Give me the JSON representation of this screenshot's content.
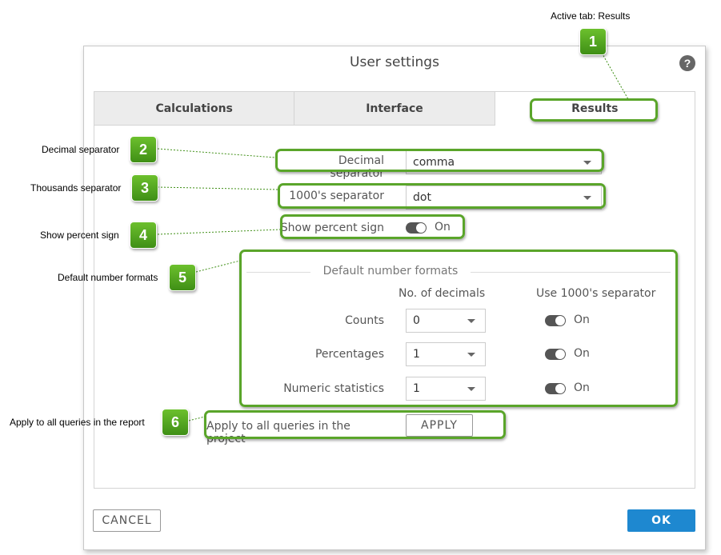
{
  "dialog": {
    "title": "User settings",
    "help_glyph": "?",
    "tabs": [
      {
        "label": "Calculations",
        "active": false
      },
      {
        "label": "Interface",
        "active": false
      },
      {
        "label": "Results",
        "active": true
      }
    ],
    "decimal_separator": {
      "label": "Decimal separator",
      "value": "comma"
    },
    "thousands_separator": {
      "label": "1000's separator",
      "value": "dot"
    },
    "percent_sign": {
      "label": "Show percent sign",
      "state": "On"
    },
    "number_formats": {
      "legend": "Default number formats",
      "col_decimals": "No. of decimals",
      "col_separator": "Use 1000's separator",
      "rows": [
        {
          "label": "Counts",
          "decimals": "0",
          "separator": "On"
        },
        {
          "label": "Percentages",
          "decimals": "1",
          "separator": "On"
        },
        {
          "label": "Numeric statistics",
          "decimals": "1",
          "separator": "On"
        }
      ]
    },
    "apply": {
      "label": "Apply to all queries in the project",
      "button": "APPLY"
    },
    "footer": {
      "cancel": "CANCEL",
      "ok": "OK"
    }
  },
  "callouts": [
    {
      "number": "1",
      "text": "Active tab: Results"
    },
    {
      "number": "2",
      "text": "Decimal separator"
    },
    {
      "number": "3",
      "text": "Thousands separator"
    },
    {
      "number": "4",
      "text": "Show percent sign"
    },
    {
      "number": "5",
      "text": "Default number formats"
    },
    {
      "number": "6",
      "text": "Apply to all queries in the report"
    }
  ],
  "colors": {
    "highlight": "#5aa52a",
    "primary": "#1e88d0"
  }
}
